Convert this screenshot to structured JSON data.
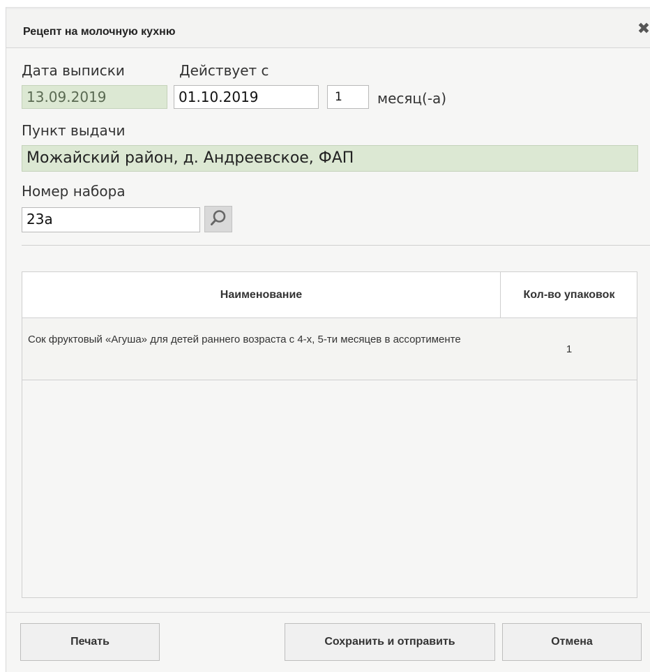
{
  "dialog": {
    "title": "Рецепт на молочную кухню",
    "close_glyph": "✖"
  },
  "form": {
    "issue_date_label": "Дата выписки",
    "issue_date_value": "13.09.2019",
    "valid_from_label": "Действует с",
    "valid_from_value": "01.10.2019",
    "months_value": "1",
    "months_unit": "месяц(-а)",
    "pickup_point_label": "Пункт выдачи",
    "pickup_point_value": "Можайский район, д. Андреевское, ФАП",
    "set_number_label": "Номер набора",
    "set_number_value": "23а",
    "search_icon": "search-icon"
  },
  "table": {
    "columns": [
      "Наименование",
      "Кол-во упаковок"
    ],
    "rows": [
      {
        "name": "Сок фруктовый «Агуша» для детей раннего возраста с 4-х, 5-ти месяцев в ассортименте",
        "qty": "1"
      }
    ]
  },
  "buttons": {
    "print": "Печать",
    "save_send": "Сохранить и отправить",
    "cancel": "Отмена"
  }
}
